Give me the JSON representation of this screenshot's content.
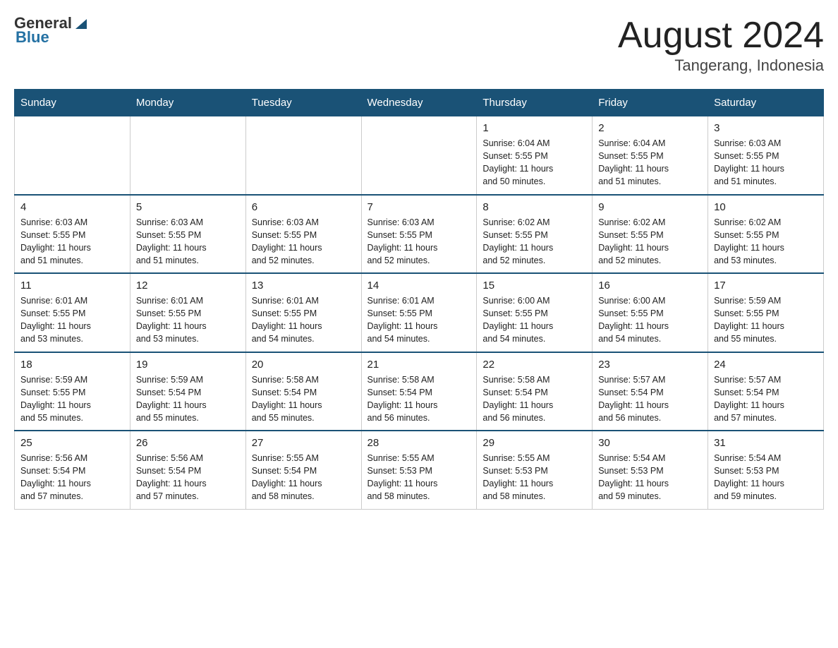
{
  "header": {
    "logo_general": "General",
    "logo_blue": "Blue",
    "month_title": "August 2024",
    "location": "Tangerang, Indonesia"
  },
  "days_of_week": [
    "Sunday",
    "Monday",
    "Tuesday",
    "Wednesday",
    "Thursday",
    "Friday",
    "Saturday"
  ],
  "weeks": [
    {
      "days": [
        {
          "num": "",
          "info": ""
        },
        {
          "num": "",
          "info": ""
        },
        {
          "num": "",
          "info": ""
        },
        {
          "num": "",
          "info": ""
        },
        {
          "num": "1",
          "info": "Sunrise: 6:04 AM\nSunset: 5:55 PM\nDaylight: 11 hours\nand 50 minutes."
        },
        {
          "num": "2",
          "info": "Sunrise: 6:04 AM\nSunset: 5:55 PM\nDaylight: 11 hours\nand 51 minutes."
        },
        {
          "num": "3",
          "info": "Sunrise: 6:03 AM\nSunset: 5:55 PM\nDaylight: 11 hours\nand 51 minutes."
        }
      ]
    },
    {
      "days": [
        {
          "num": "4",
          "info": "Sunrise: 6:03 AM\nSunset: 5:55 PM\nDaylight: 11 hours\nand 51 minutes."
        },
        {
          "num": "5",
          "info": "Sunrise: 6:03 AM\nSunset: 5:55 PM\nDaylight: 11 hours\nand 51 minutes."
        },
        {
          "num": "6",
          "info": "Sunrise: 6:03 AM\nSunset: 5:55 PM\nDaylight: 11 hours\nand 52 minutes."
        },
        {
          "num": "7",
          "info": "Sunrise: 6:03 AM\nSunset: 5:55 PM\nDaylight: 11 hours\nand 52 minutes."
        },
        {
          "num": "8",
          "info": "Sunrise: 6:02 AM\nSunset: 5:55 PM\nDaylight: 11 hours\nand 52 minutes."
        },
        {
          "num": "9",
          "info": "Sunrise: 6:02 AM\nSunset: 5:55 PM\nDaylight: 11 hours\nand 52 minutes."
        },
        {
          "num": "10",
          "info": "Sunrise: 6:02 AM\nSunset: 5:55 PM\nDaylight: 11 hours\nand 53 minutes."
        }
      ]
    },
    {
      "days": [
        {
          "num": "11",
          "info": "Sunrise: 6:01 AM\nSunset: 5:55 PM\nDaylight: 11 hours\nand 53 minutes."
        },
        {
          "num": "12",
          "info": "Sunrise: 6:01 AM\nSunset: 5:55 PM\nDaylight: 11 hours\nand 53 minutes."
        },
        {
          "num": "13",
          "info": "Sunrise: 6:01 AM\nSunset: 5:55 PM\nDaylight: 11 hours\nand 54 minutes."
        },
        {
          "num": "14",
          "info": "Sunrise: 6:01 AM\nSunset: 5:55 PM\nDaylight: 11 hours\nand 54 minutes."
        },
        {
          "num": "15",
          "info": "Sunrise: 6:00 AM\nSunset: 5:55 PM\nDaylight: 11 hours\nand 54 minutes."
        },
        {
          "num": "16",
          "info": "Sunrise: 6:00 AM\nSunset: 5:55 PM\nDaylight: 11 hours\nand 54 minutes."
        },
        {
          "num": "17",
          "info": "Sunrise: 5:59 AM\nSunset: 5:55 PM\nDaylight: 11 hours\nand 55 minutes."
        }
      ]
    },
    {
      "days": [
        {
          "num": "18",
          "info": "Sunrise: 5:59 AM\nSunset: 5:55 PM\nDaylight: 11 hours\nand 55 minutes."
        },
        {
          "num": "19",
          "info": "Sunrise: 5:59 AM\nSunset: 5:54 PM\nDaylight: 11 hours\nand 55 minutes."
        },
        {
          "num": "20",
          "info": "Sunrise: 5:58 AM\nSunset: 5:54 PM\nDaylight: 11 hours\nand 55 minutes."
        },
        {
          "num": "21",
          "info": "Sunrise: 5:58 AM\nSunset: 5:54 PM\nDaylight: 11 hours\nand 56 minutes."
        },
        {
          "num": "22",
          "info": "Sunrise: 5:58 AM\nSunset: 5:54 PM\nDaylight: 11 hours\nand 56 minutes."
        },
        {
          "num": "23",
          "info": "Sunrise: 5:57 AM\nSunset: 5:54 PM\nDaylight: 11 hours\nand 56 minutes."
        },
        {
          "num": "24",
          "info": "Sunrise: 5:57 AM\nSunset: 5:54 PM\nDaylight: 11 hours\nand 57 minutes."
        }
      ]
    },
    {
      "days": [
        {
          "num": "25",
          "info": "Sunrise: 5:56 AM\nSunset: 5:54 PM\nDaylight: 11 hours\nand 57 minutes."
        },
        {
          "num": "26",
          "info": "Sunrise: 5:56 AM\nSunset: 5:54 PM\nDaylight: 11 hours\nand 57 minutes."
        },
        {
          "num": "27",
          "info": "Sunrise: 5:55 AM\nSunset: 5:54 PM\nDaylight: 11 hours\nand 58 minutes."
        },
        {
          "num": "28",
          "info": "Sunrise: 5:55 AM\nSunset: 5:53 PM\nDaylight: 11 hours\nand 58 minutes."
        },
        {
          "num": "29",
          "info": "Sunrise: 5:55 AM\nSunset: 5:53 PM\nDaylight: 11 hours\nand 58 minutes."
        },
        {
          "num": "30",
          "info": "Sunrise: 5:54 AM\nSunset: 5:53 PM\nDaylight: 11 hours\nand 59 minutes."
        },
        {
          "num": "31",
          "info": "Sunrise: 5:54 AM\nSunset: 5:53 PM\nDaylight: 11 hours\nand 59 minutes."
        }
      ]
    }
  ]
}
